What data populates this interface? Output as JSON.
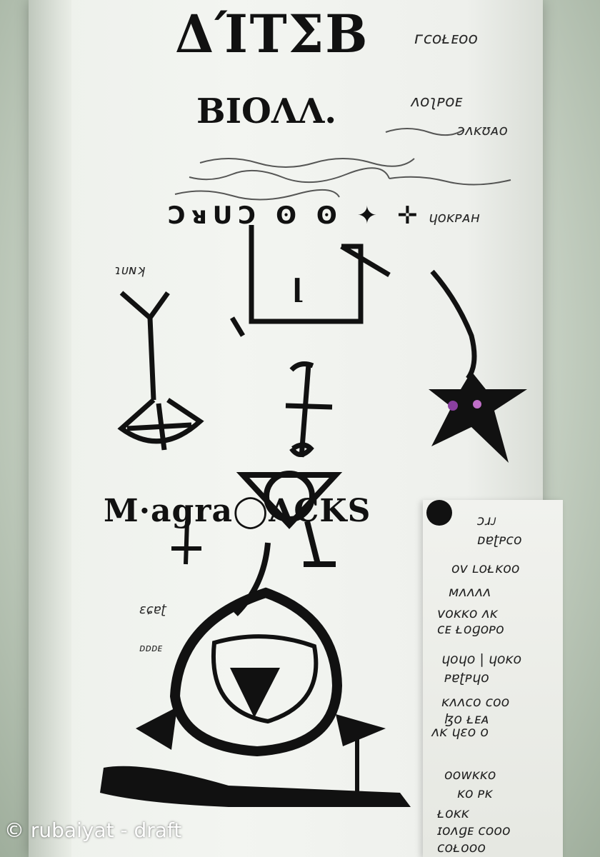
{
  "title": "ΔΊΤΣΒ",
  "subtitle": "ΒΙΟΛΛ.",
  "glyph_row": "ƆᴚUƆ ʘ ʘ ✦ ✛",
  "heading_word": "M·agra◯ACKS",
  "scribbles": {
    "top_right": "ᴦᴄᴏᴌᴇᴏᴏ",
    "right_1": "ᴧᴏʅᴘᴏᴇ",
    "right_2": "ɔᴧᴋʊᴀᴏ",
    "right_3": "ɥᴏᴋᴘᴀʜ",
    "left_mid": "ɿᴜɴʞ",
    "left_low_1": "ɛɕɐʈ",
    "left_low_2": "ᴅᴅᴅᴇ"
  },
  "note_lines": [
    "ɔɹᴊ",
    "ᴅɐʈᴘᴄᴏ",
    "ᴏᴠ ʟᴏᴌᴋᴏᴏ",
    "ᴍᴧᴧᴧᴧ",
    "ᴠᴏᴋᴋᴏ  ᴧᴋ",
    "ᴄᴇ ᴌᴏɡᴏᴘᴏ",
    "ɥᴏɥᴏ | ɥᴏᴋᴏ",
    "ᴘɐʈᴘɥᴏ",
    "ᴋᴧᴧᴄᴏ  ᴄᴏᴏ",
    "ɮᴏ ᴌᴇᴀ",
    "ᴧᴋ ɥɛᴏ ᴏ",
    "ᴏᴏᴡᴋᴋᴏ",
    "ᴋᴏ ᴘᴋ",
    "ᴌᴏᴋᴋ",
    "ɪᴏᴧɡᴇ ᴄᴏᴏᴏ",
    "ᴄᴏᴌᴏᴏᴏ"
  ],
  "watermark": "© rubaiyat - draft",
  "colors": {
    "ink": "#111111",
    "paper": "#f3f5f1",
    "accent_purple": "#8a3fa0"
  }
}
